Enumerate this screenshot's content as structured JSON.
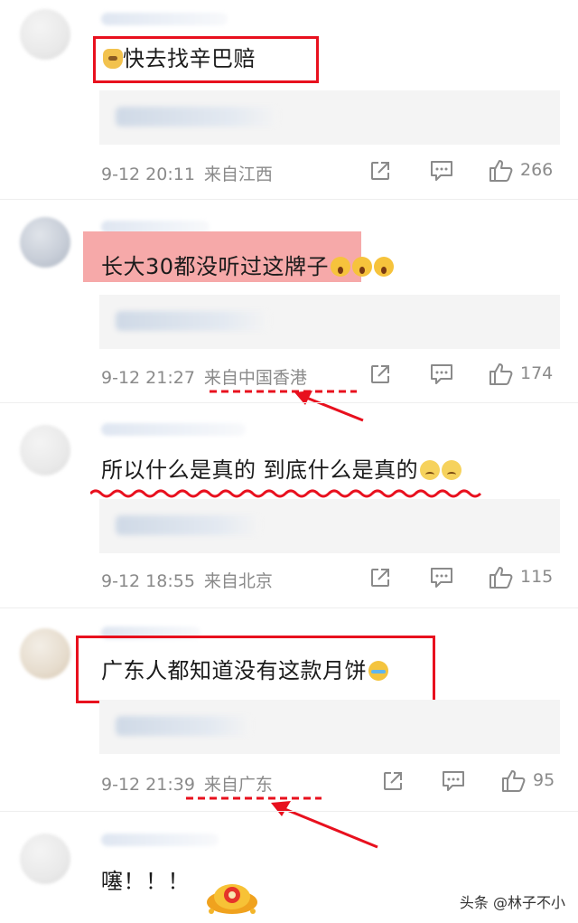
{
  "comments": [
    {
      "text": "快去找辛巴赔",
      "emoji": "dog-face",
      "time": "9-12 20:11",
      "location": "来自江西",
      "likes": "266"
    },
    {
      "text": "长大30都没听过这牌子",
      "emoji": "astonished-face",
      "time": "9-12 21:27",
      "location": "来自中国香港",
      "likes": "174"
    },
    {
      "text": "所以什么是真的 到底什么是真的",
      "emoji": "frowning-face",
      "time": "9-12 18:55",
      "location": "来自北京",
      "likes": "115"
    },
    {
      "text": "广东人都知道没有这款月饼",
      "emoji": "tears-of-joy-face",
      "time": "9-12 21:39",
      "location": "来自广东",
      "likes": "95"
    },
    {
      "text": "噻！！！",
      "emoji": "gold-ingot-sticker"
    }
  ],
  "icons": {
    "repost": "share-icon",
    "comment": "comment-icon",
    "like": "thumbs-up-icon"
  },
  "annotation_color": "#e8101e",
  "watermark": {
    "source": "头条",
    "author": "@林子不小"
  }
}
